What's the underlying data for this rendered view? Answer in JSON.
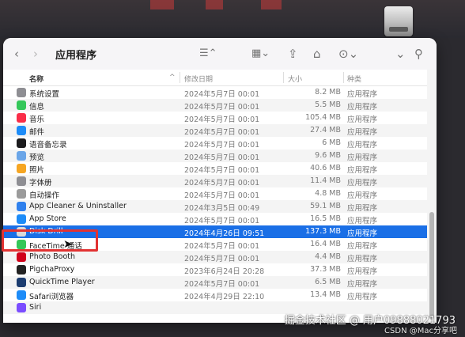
{
  "window": {
    "title": "应用程序"
  },
  "toolbar": {
    "back_icon": "chevron-left-icon",
    "forward_icon": "chevron-right-icon",
    "list_view_icon": "list-view-icon",
    "group_icon": "grid-view-icon",
    "share_icon": "share-icon",
    "tag_icon": "tag-icon",
    "more_icon": "ellipsis-circle-icon",
    "expand_icon": "chevron-down-icon",
    "search_icon": "search-icon"
  },
  "columns": {
    "name": "名称",
    "date": "修改日期",
    "size": "大小",
    "kind": "种类"
  },
  "rows": [
    {
      "name": "系统设置",
      "date": "2024年5月7日 00:01",
      "size": "8.2 MB",
      "kind": "应用程序",
      "color": "#8e8e93"
    },
    {
      "name": "信息",
      "date": "2024年5月7日 00:01",
      "size": "5.5 MB",
      "kind": "应用程序",
      "color": "#34c759"
    },
    {
      "name": "音乐",
      "date": "2024年5月7日 00:01",
      "size": "105.4 MB",
      "kind": "应用程序",
      "color": "#fa2d48"
    },
    {
      "name": "邮件",
      "date": "2024年5月7日 00:01",
      "size": "27.4 MB",
      "kind": "应用程序",
      "color": "#1d8cf8"
    },
    {
      "name": "语音备忘录",
      "date": "2024年5月7日 00:01",
      "size": "6 MB",
      "kind": "应用程序",
      "color": "#1c1c1e"
    },
    {
      "name": "预览",
      "date": "2024年5月7日 00:01",
      "size": "9.6 MB",
      "kind": "应用程序",
      "color": "#6aa5e8"
    },
    {
      "name": "照片",
      "date": "2024年5月7日 00:01",
      "size": "40.6 MB",
      "kind": "应用程序",
      "color": "#f6a623"
    },
    {
      "name": "字体册",
      "date": "2024年5月7日 00:01",
      "size": "11.4 MB",
      "kind": "应用程序",
      "color": "#8e8e93"
    },
    {
      "name": "自动操作",
      "date": "2024年5月7日 00:01",
      "size": "4.8 MB",
      "kind": "应用程序",
      "color": "#9b9b9b"
    },
    {
      "name": "App Cleaner & Uninstaller",
      "date": "2024年3月5日 00:49",
      "size": "59.1 MB",
      "kind": "应用程序",
      "color": "#2f80ed"
    },
    {
      "name": "App Store",
      "date": "2024年5月7日 00:01",
      "size": "16.5 MB",
      "kind": "应用程序",
      "color": "#1d8cf8"
    },
    {
      "name": "Disk Drill",
      "date": "2024年4月26日 09:51",
      "size": "137.3 MB",
      "kind": "应用程序",
      "color": "#d9d9d9",
      "selected": true
    },
    {
      "name": "FaceTime 通话",
      "date": "2024年5月7日 00:01",
      "size": "16.4 MB",
      "kind": "应用程序",
      "color": "#34c759"
    },
    {
      "name": "Photo Booth",
      "date": "2024年5月7日 00:01",
      "size": "4.4 MB",
      "kind": "应用程序",
      "color": "#d0021b"
    },
    {
      "name": "PigchaProxy",
      "date": "2023年6月24日 20:28",
      "size": "37.3 MB",
      "kind": "应用程序",
      "color": "#222222"
    },
    {
      "name": "QuickTime Player",
      "date": "2024年5月7日 00:01",
      "size": "6.5 MB",
      "kind": "应用程序",
      "color": "#1c3d70"
    },
    {
      "name": "Safari浏览器",
      "date": "2024年4月29日 22:10",
      "size": "13.4 MB",
      "kind": "应用程序",
      "color": "#1d8cf8"
    },
    {
      "name": "Siri",
      "date": "",
      "size": "",
      "kind": "",
      "color": "#7b4dff"
    }
  ],
  "watermark": {
    "line1": "掘金技术社区 @ 用户09888021793",
    "line2": "CSDN @Mac分享吧"
  }
}
